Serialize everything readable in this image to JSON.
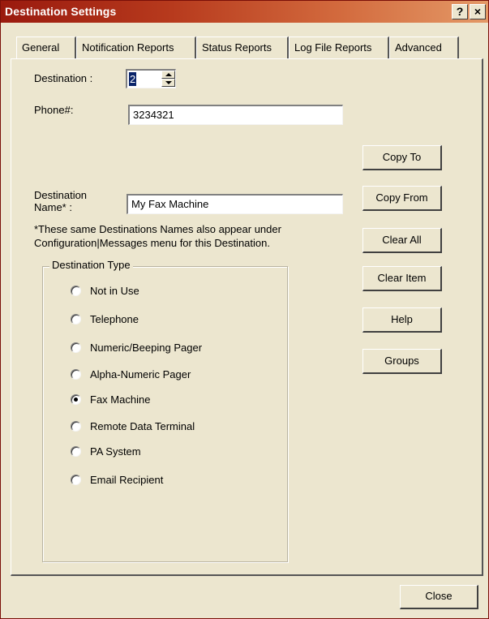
{
  "window": {
    "title": "Destination Settings",
    "help_label": "?",
    "close_glyph": "×"
  },
  "tabs": [
    {
      "label": "General",
      "active": true
    },
    {
      "label": "Notification Reports",
      "active": false
    },
    {
      "label": "Status Reports",
      "active": false
    },
    {
      "label": "Log File Reports",
      "active": false
    },
    {
      "label": "Advanced",
      "active": false
    }
  ],
  "form": {
    "destination_label": "Destination :",
    "destination_value": "2",
    "phone_label": "Phone#:",
    "phone_value": "3234321",
    "name_label_line1": "Destination",
    "name_label_line2": "Name* :",
    "name_value": "My Fax Machine",
    "note_line1": "*These same Destinations Names also appear under",
    "note_line2": "Configuration|Messages menu for this Destination."
  },
  "destination_type": {
    "legend": "Destination Type",
    "options": [
      {
        "label": "Not in Use",
        "selected": false
      },
      {
        "label": "Telephone",
        "selected": false
      },
      {
        "label": "Numeric/Beeping Pager",
        "selected": false
      },
      {
        "label": "Alpha-Numeric Pager",
        "selected": false
      },
      {
        "label": "Fax Machine",
        "selected": true
      },
      {
        "label": "Remote Data Terminal",
        "selected": false
      },
      {
        "label": "PA System",
        "selected": false
      },
      {
        "label": "Email Recipient",
        "selected": false
      }
    ]
  },
  "actions": {
    "copy_to": "Copy To",
    "copy_from": "Copy From",
    "clear_all": "Clear All",
    "clear_item": "Clear Item",
    "help": "Help",
    "groups": "Groups"
  },
  "footer": {
    "close_label": "Close"
  },
  "colors": {
    "title_start": "#9a1a0e",
    "title_end": "#e49967",
    "window_bg": "#ece6cf",
    "selection": "#0a246a"
  }
}
